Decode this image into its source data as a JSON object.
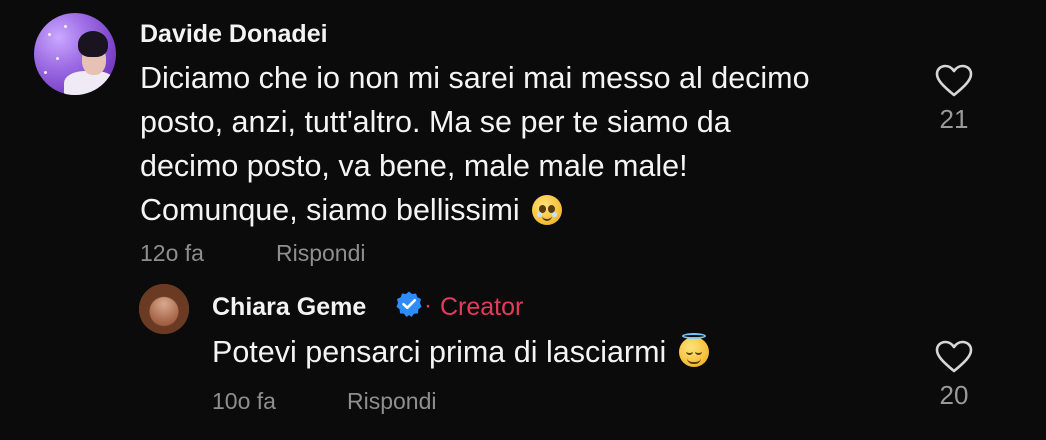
{
  "comment": {
    "author": "Davide Donadei",
    "lines": [
      "Diciamo che io non mi sarei mai messo al decimo",
      "posto, anzi, tutt'altro. Ma se per te siamo da",
      "decimo posto, va bene, male male male!",
      "Comunque, siamo bellissimi"
    ],
    "emoji": "pleading-face-emoji",
    "time": "12o fa",
    "reply_label": "Rispondi",
    "likes": "21"
  },
  "reply": {
    "author": "Chiara Geme",
    "badge_separator": "·",
    "badge": "Creator",
    "text": "Potevi pensarci prima di lasciarmi",
    "emoji": "smiling-face-with-halo-emoji",
    "time": "10o fa",
    "reply_label": "Rispondi",
    "likes": "20"
  },
  "colors": {
    "background": "#0b0b0b",
    "creator": "#e43a5e",
    "verified": "#2f8cff",
    "muted": "#8e8e8e"
  },
  "icons": {
    "like": "heart-outline-icon",
    "verified": "verified-check-icon"
  }
}
